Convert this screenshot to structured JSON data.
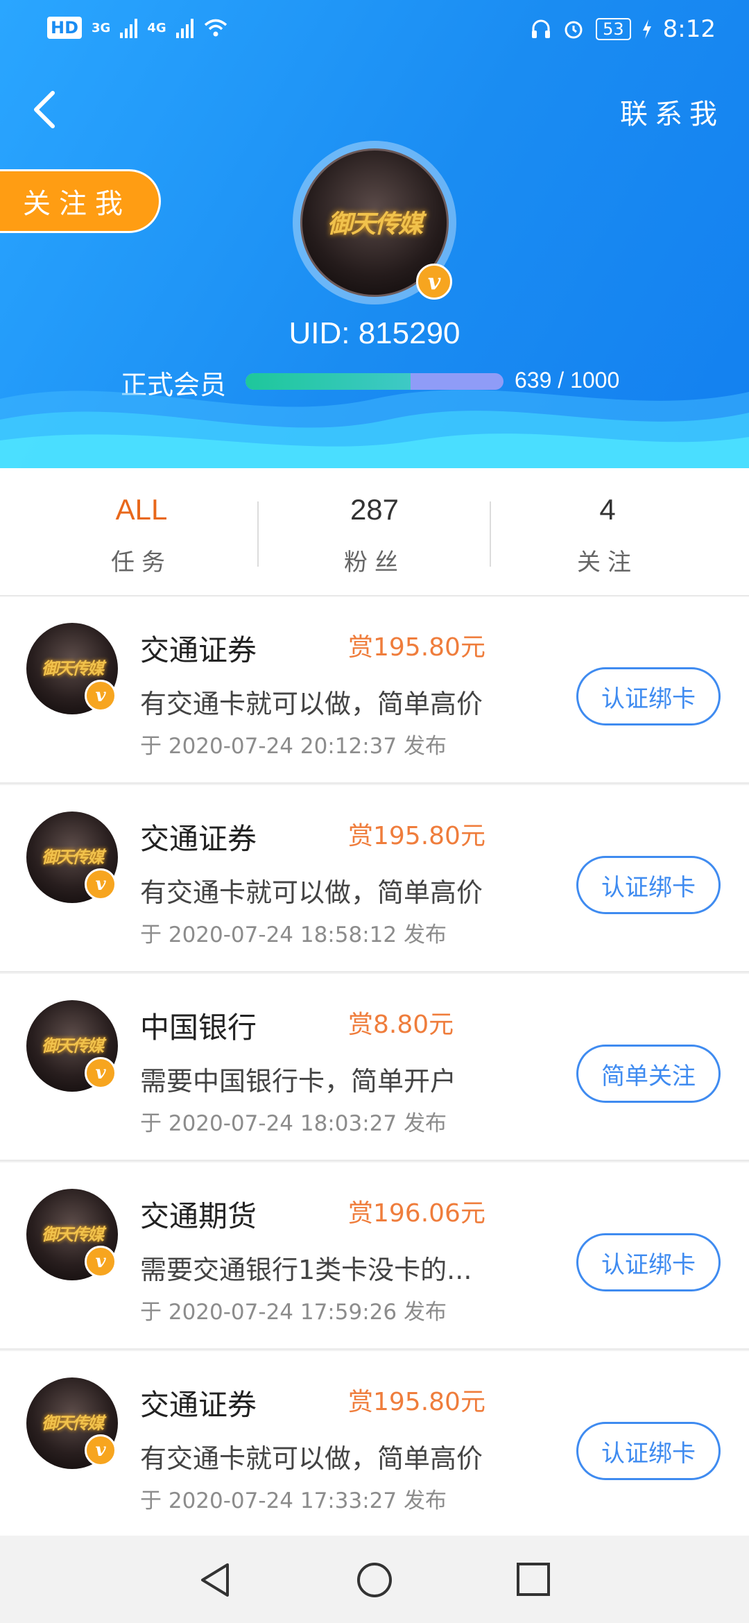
{
  "status_bar": {
    "hd": "HD",
    "net1": "3G",
    "net2": "4G",
    "battery": "53",
    "time": "8:12"
  },
  "header": {
    "contact_label": "联系我",
    "follow_label": "关注我",
    "logo_text": "御天传媒",
    "vip_badge": "v",
    "uid": "UID: 815290",
    "member_level": "正式会员",
    "progress_text": "639 / 1000",
    "progress_fraction": 0.639
  },
  "stats": [
    {
      "value": "ALL",
      "label": "任务"
    },
    {
      "value": "287",
      "label": "粉丝"
    },
    {
      "value": "4",
      "label": "关注"
    }
  ],
  "tasks": [
    {
      "title": "交通证券",
      "reward": "赏195.80元",
      "desc": "有交通卡就可以做，简单高价",
      "time": "于 2020-07-24 20:12:37 发布",
      "action": "认证绑卡"
    },
    {
      "title": "交通证券",
      "reward": "赏195.80元",
      "desc": "有交通卡就可以做，简单高价",
      "time": "于 2020-07-24 18:58:12 发布",
      "action": "认证绑卡"
    },
    {
      "title": "中国银行",
      "reward": "赏8.80元",
      "desc": "需要中国银行卡，简单开户",
      "time": "于 2020-07-24 18:03:27 发布",
      "action": "简单关注"
    },
    {
      "title": "交通期货",
      "reward": "赏196.06元",
      "desc": "需要交通银行1类卡没卡的...",
      "time": "于 2020-07-24 17:59:26 发布",
      "action": "认证绑卡"
    },
    {
      "title": "交通证券",
      "reward": "赏195.80元",
      "desc": "有交通卡就可以做，简单高价",
      "time": "于 2020-07-24 17:33:27 发布",
      "action": "认证绑卡"
    }
  ],
  "colors": {
    "header_blue": "#1a8cf2",
    "accent_orange": "#ff9d13",
    "reward_orange": "#ef7d3c",
    "action_blue": "#3f8bf0"
  },
  "icons": [
    "back-arrow-icon",
    "wifi-icon",
    "headphones-icon",
    "alarm-icon",
    "charging-icon",
    "nav-back-icon",
    "nav-home-icon",
    "nav-recents-icon"
  ]
}
